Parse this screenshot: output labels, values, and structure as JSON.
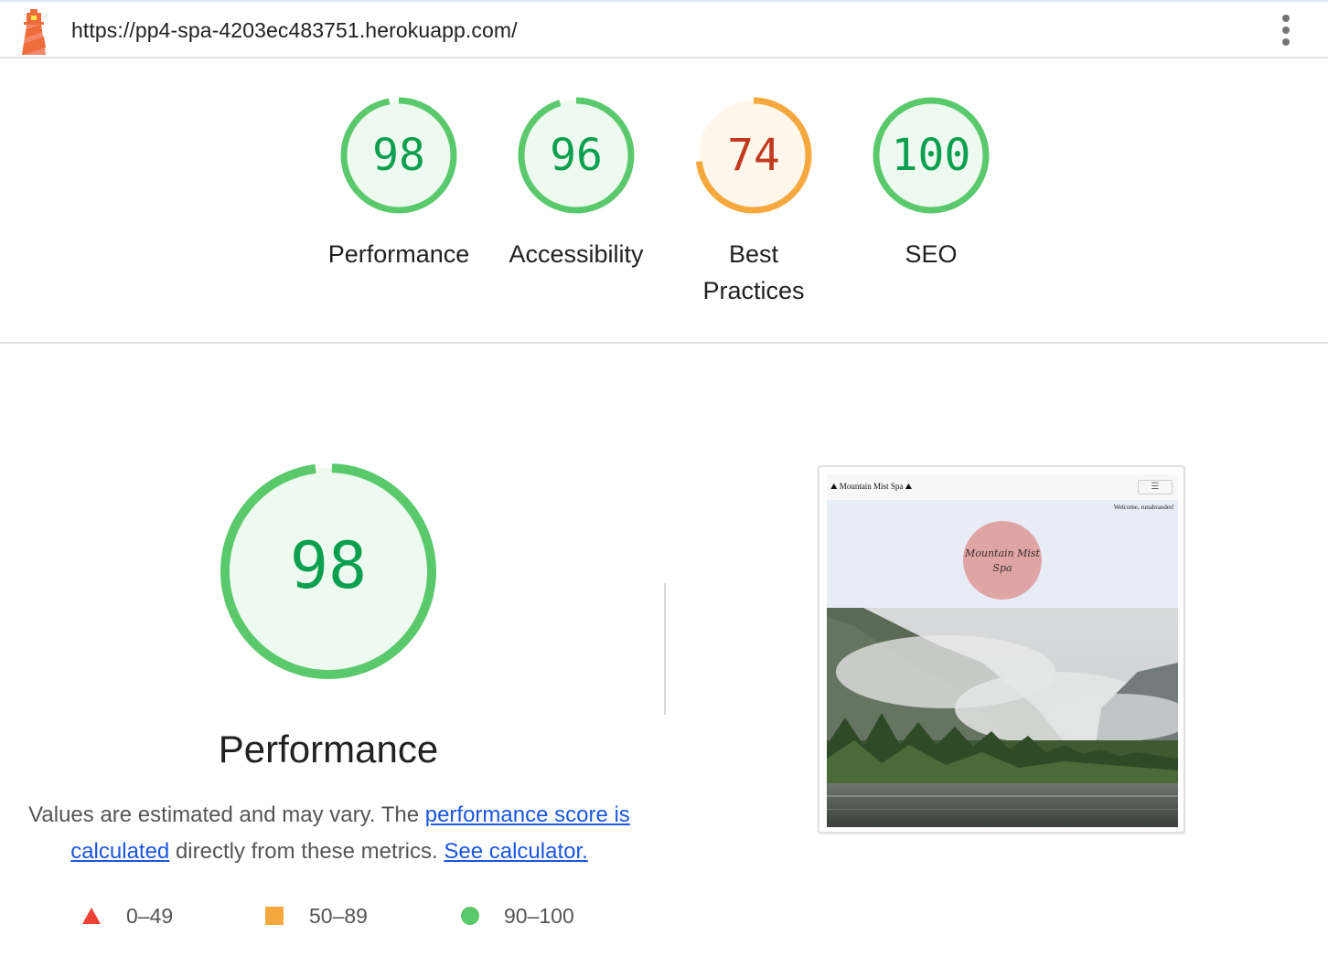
{
  "browser": {
    "url": "https://pp4-spa-4203ec483751.herokuapp.com/",
    "logo_icon": "lighthouse-icon",
    "menu_icon": "kebab-menu-icon"
  },
  "colors": {
    "pass": "#0c9f4f",
    "pass_ring": "#5ac96c",
    "pass_bg": "#eefaf0",
    "average": "#c23a1e",
    "average_ring": "#f4a83e",
    "average_bg": "#fff6ec",
    "fail": "#eb4335"
  },
  "categories": [
    {
      "score": "98",
      "label": "Performance",
      "value": 98
    },
    {
      "score": "96",
      "label": "Accessibility",
      "value": 96
    },
    {
      "score": "74",
      "label": "Best Practices",
      "value": 74
    },
    {
      "score": "100",
      "label": "SEO",
      "value": 100
    }
  ],
  "performance": {
    "score": "98",
    "value": 98,
    "title": "Performance",
    "desc_prefix": "Values are estimated and may vary. The ",
    "link_score": "performance score is calculated",
    "desc_middle": " directly from these metrics. ",
    "link_calculator": "See calculator."
  },
  "legend": [
    {
      "shape": "triangle",
      "range": "0–49"
    },
    {
      "shape": "square",
      "range": "50–89"
    },
    {
      "shape": "circle",
      "range": "90–100"
    }
  ],
  "screenshot": {
    "brand": "⛰ Mountain Mist Spa ⛰",
    "menu": "☰",
    "welcome": "Welcome, runabrandes!",
    "logo_line1": "Mountain Mist",
    "logo_line2": "Spa"
  }
}
